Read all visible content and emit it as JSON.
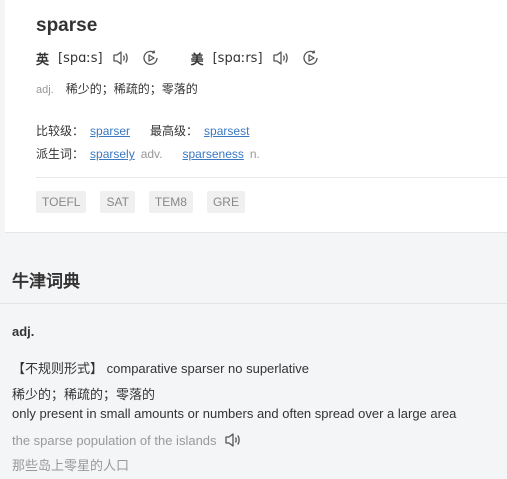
{
  "entry": {
    "word": "sparse",
    "pronunciations": [
      {
        "region": "英",
        "ipa": "[spɑːs]"
      },
      {
        "region": "美",
        "ipa": "[spɑːrs]"
      }
    ],
    "pos": "adj.",
    "definition": "稀少的；稀疏的；零落的",
    "forms": {
      "comparative_label": "比较级：",
      "comparative": "sparser",
      "superlative_label": "最高级：",
      "superlative": "sparsest",
      "derived_label": "派生词：",
      "derived": [
        {
          "word": "sparsely",
          "pos": "adv."
        },
        {
          "word": "sparseness",
          "pos": "n."
        }
      ]
    },
    "tags": [
      "TOEFL",
      "SAT",
      "TEM8",
      "GRE"
    ]
  },
  "oxford": {
    "title": "牛津词典",
    "pos": "adj.",
    "irregular_label": "【不规则形式】",
    "irregular_text": "comparative sparser no superlative",
    "cn_definition": "稀少的；稀疏的；零落的",
    "en_definition": "only present in small amounts or numbers and often spread over a large area",
    "example_en": "the sparse population of the islands",
    "example_cn": "那些岛上零星的人口"
  }
}
